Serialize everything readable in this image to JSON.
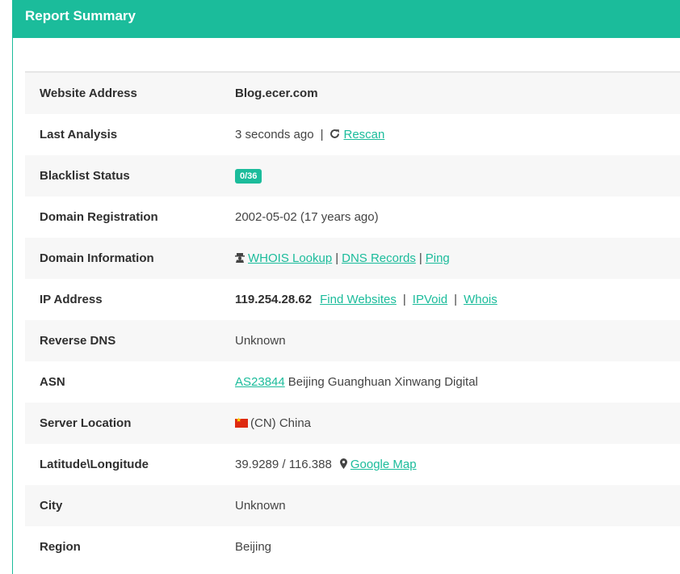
{
  "header": {
    "title": "Report Summary"
  },
  "rows": {
    "website": {
      "label": "Website Address",
      "value": "Blog.ecer.com"
    },
    "last_analysis": {
      "label": "Last Analysis",
      "time": "3 seconds ago",
      "sep": "|",
      "rescan": "Rescan"
    },
    "blacklist": {
      "label": "Blacklist Status",
      "badge": "0/36"
    },
    "registration": {
      "label": "Domain Registration",
      "value": "2002-05-02 (17 years ago)"
    },
    "domain_info": {
      "label": "Domain Information",
      "whois": "WHOIS Lookup",
      "dns": "DNS Records",
      "ping": "Ping",
      "sep": "|"
    },
    "ip": {
      "label": "IP Address",
      "value": "119.254.28.62",
      "find": "Find Websites",
      "ipvoid": "IPVoid",
      "whois": "Whois",
      "sep": "|"
    },
    "reverse_dns": {
      "label": "Reverse DNS",
      "value": "Unknown"
    },
    "asn": {
      "label": "ASN",
      "link": "AS23844",
      "name": "Beijing Guanghuan Xinwang Digital"
    },
    "server_location": {
      "label": "Server Location",
      "value": "(CN) China"
    },
    "latlong": {
      "label": "Latitude\\Longitude",
      "value": "39.9289 / 116.388",
      "map": "Google Map"
    },
    "city": {
      "label": "City",
      "value": "Unknown"
    },
    "region": {
      "label": "Region",
      "value": "Beijing"
    }
  },
  "icons": {
    "rescan": "refresh-icon",
    "domain_info": "user-secret-icon",
    "map": "map-marker-icon",
    "flag": "china-flag-icon"
  },
  "colors": {
    "accent": "#1bbc9b"
  }
}
